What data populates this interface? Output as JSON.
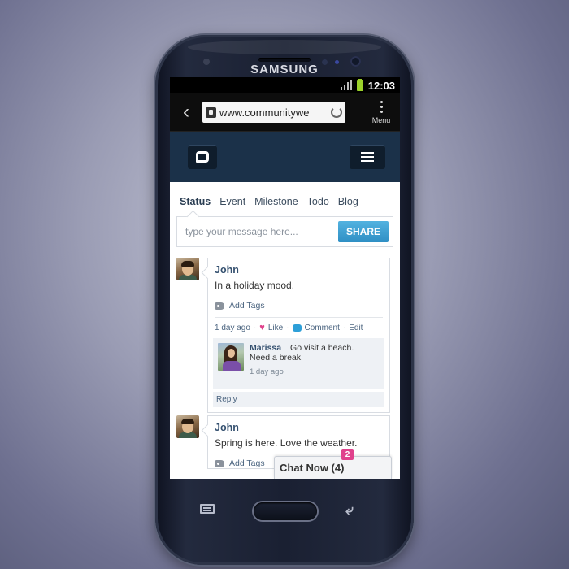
{
  "device": {
    "brand": "SAMSUNG"
  },
  "statusbar": {
    "time": "12:03"
  },
  "browser": {
    "url": "www.communitywe",
    "menu_label": "Menu"
  },
  "tabs": [
    {
      "label": "Status",
      "active": true
    },
    {
      "label": "Event",
      "active": false
    },
    {
      "label": "Milestone",
      "active": false
    },
    {
      "label": "Todo",
      "active": false
    },
    {
      "label": "Blog",
      "active": false
    }
  ],
  "composer": {
    "placeholder": "type your message here...",
    "share_label": "SHARE"
  },
  "posts": [
    {
      "author": "John",
      "text": "In a holiday mood.",
      "add_tags": "Add Tags",
      "time": "1 day ago",
      "like": "Like",
      "comment": "Comment",
      "edit": "Edit",
      "reply": "Reply",
      "comments": [
        {
          "author": "Marissa",
          "text_line1": "Go visit a beach.",
          "text_line2": "Need a break.",
          "time": "1 day ago"
        }
      ]
    },
    {
      "author": "John",
      "text": "Spring is here. Love the weather.",
      "add_tags": "Add Tags"
    }
  ],
  "chat": {
    "label": "Chat Now (4)",
    "badge": "2"
  },
  "colors": {
    "header": "#1b3149",
    "accent": "#3b9ccf",
    "like": "#e0418c"
  }
}
